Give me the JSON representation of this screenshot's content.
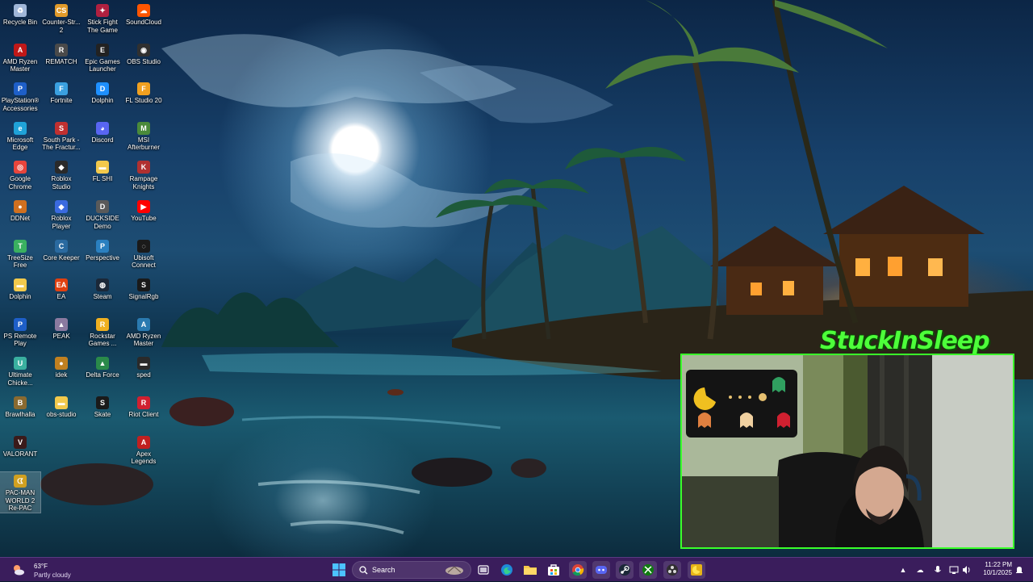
{
  "desktop": {
    "icons": [
      {
        "label": "Recycle Bin",
        "icon": "recycle-bin-icon",
        "color": "#9fb6d8",
        "glyph": "♻"
      },
      {
        "label": "Counter-Str... 2",
        "icon": "counter-strike-icon",
        "color": "#e09a2a",
        "glyph": "CS"
      },
      {
        "label": "Stick Fight The Game",
        "icon": "stick-fight-icon",
        "color": "#b02040",
        "glyph": "✦"
      },
      {
        "label": "SoundCloud",
        "icon": "soundcloud-icon",
        "color": "#ff5500",
        "glyph": "☁"
      },
      {
        "label": "AMD Ryzen Master",
        "icon": "amd-ryzen-icon",
        "color": "#c01818",
        "glyph": "A"
      },
      {
        "label": "REMATCH",
        "icon": "rematch-icon",
        "color": "#4a4a4a",
        "glyph": "R"
      },
      {
        "label": "Epic Games Launcher",
        "icon": "epic-games-icon",
        "color": "#222222",
        "glyph": "E"
      },
      {
        "label": "OBS Studio",
        "icon": "obs-icon",
        "color": "#303030",
        "glyph": "◉"
      },
      {
        "label": "PlayStation® Accessories",
        "icon": "playstation-icon",
        "color": "#1e5fc8",
        "glyph": "P"
      },
      {
        "label": "Fortnite",
        "icon": "fortnite-icon",
        "color": "#3aa0e0",
        "glyph": "F"
      },
      {
        "label": "Dolphin",
        "icon": "dolphin-icon",
        "color": "#1e90ff",
        "glyph": "D"
      },
      {
        "label": "FL Studio 20",
        "icon": "fl-studio-icon",
        "color": "#f0a020",
        "glyph": "F"
      },
      {
        "label": "Microsoft Edge",
        "icon": "edge-icon",
        "color": "#1fa2d8",
        "glyph": "e"
      },
      {
        "label": "South Park - The Fractur...",
        "icon": "south-park-icon",
        "color": "#c03030",
        "glyph": "S"
      },
      {
        "label": "Discord",
        "icon": "discord-icon",
        "color": "#5865f2",
        "glyph": "◕"
      },
      {
        "label": "MSI Afterburner",
        "icon": "msi-afterburner-icon",
        "color": "#4a8a3a",
        "glyph": "M"
      },
      {
        "label": "Google Chrome",
        "icon": "chrome-icon",
        "color": "#e8453c",
        "glyph": "◎"
      },
      {
        "label": "Roblox Studio",
        "icon": "roblox-studio-icon",
        "color": "#2a2a2a",
        "glyph": "◆"
      },
      {
        "label": "FL SHI",
        "icon": "fl-shi-folder-icon",
        "color": "#f2c94c",
        "glyph": "▬"
      },
      {
        "label": "Rampage Knights",
        "icon": "rampage-knights-icon",
        "color": "#b03030",
        "glyph": "K"
      },
      {
        "label": "DDNet",
        "icon": "ddnet-icon",
        "color": "#d07020",
        "glyph": "●"
      },
      {
        "label": "Roblox Player",
        "icon": "roblox-player-icon",
        "color": "#3a6ae0",
        "glyph": "◆"
      },
      {
        "label": "DUCKSIDE Demo",
        "icon": "duckside-icon",
        "color": "#5a5a5a",
        "glyph": "D"
      },
      {
        "label": "YouTube",
        "icon": "youtube-icon",
        "color": "#ff0000",
        "glyph": "▶"
      },
      {
        "label": "TreeSize Free",
        "icon": "treesize-icon",
        "color": "#3ab060",
        "glyph": "T"
      },
      {
        "label": "Core Keeper",
        "icon": "core-keeper-icon",
        "color": "#2a6aa0",
        "glyph": "C"
      },
      {
        "label": "Perspective",
        "icon": "perspective-icon",
        "color": "#2a80c0",
        "glyph": "P"
      },
      {
        "label": "Ubisoft Connect",
        "icon": "ubisoft-icon",
        "color": "#1a1a1a",
        "glyph": "◌"
      },
      {
        "label": "Dolphin",
        "icon": "dolphin-folder-icon",
        "color": "#f2c94c",
        "glyph": "▬"
      },
      {
        "label": "EA",
        "icon": "ea-icon",
        "color": "#e04010",
        "glyph": "EA"
      },
      {
        "label": "Steam",
        "icon": "steam-icon",
        "color": "#1b2838",
        "glyph": "◍"
      },
      {
        "label": "SignalRgb",
        "icon": "signalrgb-icon",
        "color": "#1a1a1a",
        "glyph": "S"
      },
      {
        "label": "PS Remote Play",
        "icon": "ps-remote-play-icon",
        "color": "#1e5fc8",
        "glyph": "P"
      },
      {
        "label": "PEAK",
        "icon": "peak-icon",
        "color": "#8a7aa0",
        "glyph": "▲"
      },
      {
        "label": "Rockstar Games ...",
        "icon": "rockstar-icon",
        "color": "#f0b020",
        "glyph": "R"
      },
      {
        "label": "AMD Ryzen Master",
        "icon": "amd-ryzen-2-icon",
        "color": "#2a7ab0",
        "glyph": "A"
      },
      {
        "label": "Ultimate Chicke...",
        "icon": "ultimate-chicken-horse-icon",
        "color": "#3ab0a0",
        "glyph": "U"
      },
      {
        "label": "idek",
        "icon": "idek-icon",
        "color": "#c08020",
        "glyph": "●"
      },
      {
        "label": "Delta Force",
        "icon": "delta-force-icon",
        "color": "#2a8a4a",
        "glyph": "▲"
      },
      {
        "label": "sped",
        "icon": "sped-icon",
        "color": "#2a2a2a",
        "glyph": "▬"
      },
      {
        "label": "Brawlhalla",
        "icon": "brawlhalla-icon",
        "color": "#8a6a30",
        "glyph": "B"
      },
      {
        "label": "obs-studio",
        "icon": "obs-studio-folder-icon",
        "color": "#f2c94c",
        "glyph": "▬"
      },
      {
        "label": "Skate",
        "icon": "skate-icon",
        "color": "#1a1a1a",
        "glyph": "S"
      },
      {
        "label": "Riot Client",
        "icon": "riot-client-icon",
        "color": "#d02030",
        "glyph": "R"
      },
      {
        "label": "VALORANT",
        "icon": "valorant-icon",
        "color": "#3a1a1a",
        "glyph": "V"
      },
      {
        "label": "Apex Legends",
        "icon": "apex-legends-icon",
        "color": "#c02020",
        "glyph": "A"
      },
      {
        "label": "PAC-MAN WORLD 2 Re-PAC",
        "icon": "pacman-world-icon",
        "color": "#d0a020",
        "glyph": "ᗧ"
      }
    ]
  },
  "stream_overlay": {
    "streamer_name": "StuckInSleep"
  },
  "taskbar": {
    "weather": {
      "temp": "63°F",
      "condition": "Partly cloudy"
    },
    "search_label": "Search",
    "clock": {
      "time": "11:22 PM",
      "date": "10/1/2025"
    },
    "accent_color": "#3a1d5c"
  }
}
